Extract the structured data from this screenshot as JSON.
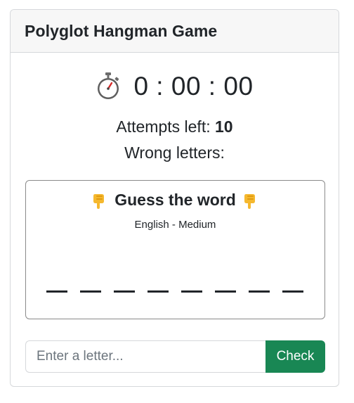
{
  "header": {
    "title": "Polyglot Hangman Game"
  },
  "timer": {
    "icon": "stopwatch-icon",
    "value": "0 : 00 : 00"
  },
  "stats": {
    "attempts_label": "Attempts left: ",
    "attempts_value": "10",
    "wrong_label": "Wrong letters:"
  },
  "word": {
    "title": "Guess the word",
    "left_icon": "pointing-down-hand-icon",
    "right_icon": "pointing-down-hand-icon",
    "subtitle": "English - Medium",
    "letter_count": 8
  },
  "input": {
    "placeholder": "Enter a letter...",
    "value": ""
  },
  "button": {
    "label": "Check"
  },
  "colors": {
    "button_bg": "#198754",
    "header_bg": "#f7f7f7",
    "text": "#212529"
  }
}
